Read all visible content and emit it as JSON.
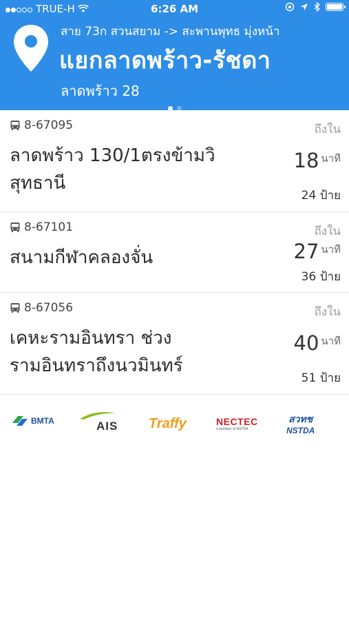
{
  "status_bar": {
    "carrier": "TRUE-H",
    "time": "6:26 AM"
  },
  "header": {
    "route": "สาย 73ก สวนสยาม -> สะพานพุทธ มุ่งหน้า",
    "stop_name": "แยกลาดพร้าว-รัชดา",
    "sub_stop": "ลาดพร้าว 28",
    "page_index": 0,
    "page_count": 2,
    "color": "#2e8de6"
  },
  "buses": [
    {
      "id": "8-67095",
      "destination_line1": "ลาดพร้าว 130/1ตรงข้ามวิ",
      "destination_line2": "สุทธานี",
      "arrive_label": "ถึงใน",
      "minutes": "18",
      "minutes_unit": "นาที",
      "stops": "24 ป้าย"
    },
    {
      "id": "8-67101",
      "destination_line1": "สนามกีฬาคลองจั่น",
      "destination_line2": "",
      "arrive_label": "ถึงใน",
      "minutes": "27",
      "minutes_unit": "นาที",
      "stops": "36 ป้าย"
    },
    {
      "id": "8-67056",
      "destination_line1": "เคหะรามอินทรา ช่วง",
      "destination_line2": "รามอินทราถึงนวมินทร์",
      "arrive_label": "ถึงใน",
      "minutes": "40",
      "minutes_unit": "นาที",
      "stops": "51 ป้าย"
    }
  ],
  "logos": {
    "bmta": "BMTA",
    "ais": "AIS",
    "traffy": "Traffy",
    "nectec": "NECTEC",
    "nectec_tag": "a member of NSTDA",
    "nstda_th": "สวทช",
    "nstda": "NSTDA"
  }
}
